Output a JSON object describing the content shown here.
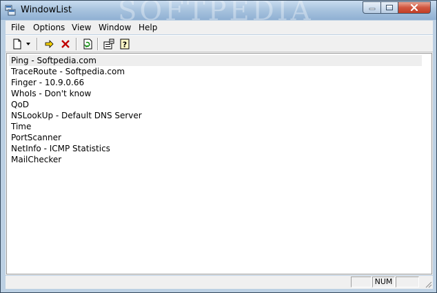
{
  "window": {
    "title": "WindowList",
    "watermark": "SOFTPEDIA"
  },
  "titlebar_buttons": {
    "minimize": "minimize-icon",
    "maximize": "maximize-icon",
    "close": "close-icon"
  },
  "menu": {
    "items": [
      "File",
      "Options",
      "View",
      "Window",
      "Help"
    ]
  },
  "toolbar": {
    "buttons": [
      "new-document-icon",
      "dropdown-arrow-icon",
      "execute-arrow-icon",
      "delete-icon",
      "refresh-icon",
      "properties-icon",
      "help-icon"
    ]
  },
  "list": {
    "items": [
      "Ping - Softpedia.com",
      "TraceRoute - Softpedia.com",
      "Finger - 10.9.0.66",
      "WhoIs - Don't know",
      "QoD",
      "NSLookUp - Default DNS Server",
      "Time",
      "PortScanner",
      "NetInfo - ICMP Statistics",
      "MailChecker"
    ],
    "selected_index": 0
  },
  "status": {
    "num": "NUM"
  },
  "colors": {
    "titlebar": "#a9c4df",
    "close_button": "#c94a33",
    "face": "#f0f0f0",
    "selection": "#eeeeee"
  }
}
